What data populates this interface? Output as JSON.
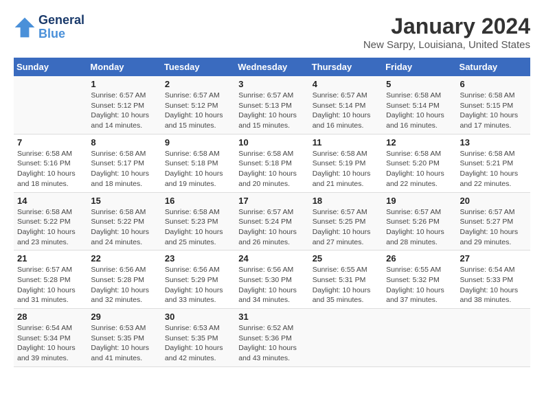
{
  "logo": {
    "line1": "General",
    "line2": "Blue"
  },
  "title": "January 2024",
  "location": "New Sarpy, Louisiana, United States",
  "days_header": [
    "Sunday",
    "Monday",
    "Tuesday",
    "Wednesday",
    "Thursday",
    "Friday",
    "Saturday"
  ],
  "weeks": [
    [
      {
        "day": "",
        "info": ""
      },
      {
        "day": "1",
        "info": "Sunrise: 6:57 AM\nSunset: 5:12 PM\nDaylight: 10 hours\nand 14 minutes."
      },
      {
        "day": "2",
        "info": "Sunrise: 6:57 AM\nSunset: 5:12 PM\nDaylight: 10 hours\nand 15 minutes."
      },
      {
        "day": "3",
        "info": "Sunrise: 6:57 AM\nSunset: 5:13 PM\nDaylight: 10 hours\nand 15 minutes."
      },
      {
        "day": "4",
        "info": "Sunrise: 6:57 AM\nSunset: 5:14 PM\nDaylight: 10 hours\nand 16 minutes."
      },
      {
        "day": "5",
        "info": "Sunrise: 6:58 AM\nSunset: 5:14 PM\nDaylight: 10 hours\nand 16 minutes."
      },
      {
        "day": "6",
        "info": "Sunrise: 6:58 AM\nSunset: 5:15 PM\nDaylight: 10 hours\nand 17 minutes."
      }
    ],
    [
      {
        "day": "7",
        "info": "Sunrise: 6:58 AM\nSunset: 5:16 PM\nDaylight: 10 hours\nand 18 minutes."
      },
      {
        "day": "8",
        "info": "Sunrise: 6:58 AM\nSunset: 5:17 PM\nDaylight: 10 hours\nand 18 minutes."
      },
      {
        "day": "9",
        "info": "Sunrise: 6:58 AM\nSunset: 5:18 PM\nDaylight: 10 hours\nand 19 minutes."
      },
      {
        "day": "10",
        "info": "Sunrise: 6:58 AM\nSunset: 5:18 PM\nDaylight: 10 hours\nand 20 minutes."
      },
      {
        "day": "11",
        "info": "Sunrise: 6:58 AM\nSunset: 5:19 PM\nDaylight: 10 hours\nand 21 minutes."
      },
      {
        "day": "12",
        "info": "Sunrise: 6:58 AM\nSunset: 5:20 PM\nDaylight: 10 hours\nand 22 minutes."
      },
      {
        "day": "13",
        "info": "Sunrise: 6:58 AM\nSunset: 5:21 PM\nDaylight: 10 hours\nand 22 minutes."
      }
    ],
    [
      {
        "day": "14",
        "info": "Sunrise: 6:58 AM\nSunset: 5:22 PM\nDaylight: 10 hours\nand 23 minutes."
      },
      {
        "day": "15",
        "info": "Sunrise: 6:58 AM\nSunset: 5:22 PM\nDaylight: 10 hours\nand 24 minutes."
      },
      {
        "day": "16",
        "info": "Sunrise: 6:58 AM\nSunset: 5:23 PM\nDaylight: 10 hours\nand 25 minutes."
      },
      {
        "day": "17",
        "info": "Sunrise: 6:57 AM\nSunset: 5:24 PM\nDaylight: 10 hours\nand 26 minutes."
      },
      {
        "day": "18",
        "info": "Sunrise: 6:57 AM\nSunset: 5:25 PM\nDaylight: 10 hours\nand 27 minutes."
      },
      {
        "day": "19",
        "info": "Sunrise: 6:57 AM\nSunset: 5:26 PM\nDaylight: 10 hours\nand 28 minutes."
      },
      {
        "day": "20",
        "info": "Sunrise: 6:57 AM\nSunset: 5:27 PM\nDaylight: 10 hours\nand 29 minutes."
      }
    ],
    [
      {
        "day": "21",
        "info": "Sunrise: 6:57 AM\nSunset: 5:28 PM\nDaylight: 10 hours\nand 31 minutes."
      },
      {
        "day": "22",
        "info": "Sunrise: 6:56 AM\nSunset: 5:28 PM\nDaylight: 10 hours\nand 32 minutes."
      },
      {
        "day": "23",
        "info": "Sunrise: 6:56 AM\nSunset: 5:29 PM\nDaylight: 10 hours\nand 33 minutes."
      },
      {
        "day": "24",
        "info": "Sunrise: 6:56 AM\nSunset: 5:30 PM\nDaylight: 10 hours\nand 34 minutes."
      },
      {
        "day": "25",
        "info": "Sunrise: 6:55 AM\nSunset: 5:31 PM\nDaylight: 10 hours\nand 35 minutes."
      },
      {
        "day": "26",
        "info": "Sunrise: 6:55 AM\nSunset: 5:32 PM\nDaylight: 10 hours\nand 37 minutes."
      },
      {
        "day": "27",
        "info": "Sunrise: 6:54 AM\nSunset: 5:33 PM\nDaylight: 10 hours\nand 38 minutes."
      }
    ],
    [
      {
        "day": "28",
        "info": "Sunrise: 6:54 AM\nSunset: 5:34 PM\nDaylight: 10 hours\nand 39 minutes."
      },
      {
        "day": "29",
        "info": "Sunrise: 6:53 AM\nSunset: 5:35 PM\nDaylight: 10 hours\nand 41 minutes."
      },
      {
        "day": "30",
        "info": "Sunrise: 6:53 AM\nSunset: 5:35 PM\nDaylight: 10 hours\nand 42 minutes."
      },
      {
        "day": "31",
        "info": "Sunrise: 6:52 AM\nSunset: 5:36 PM\nDaylight: 10 hours\nand 43 minutes."
      },
      {
        "day": "",
        "info": ""
      },
      {
        "day": "",
        "info": ""
      },
      {
        "day": "",
        "info": ""
      }
    ]
  ]
}
